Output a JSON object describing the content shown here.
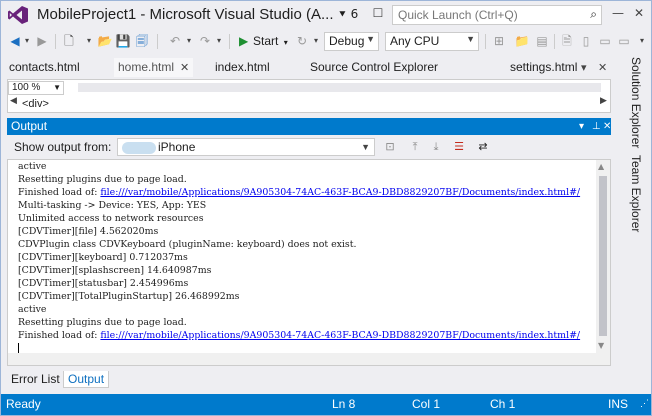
{
  "window": {
    "title": "MobileProject1 - Microsoft Visual Studio (A...",
    "notifications_count": "6",
    "quick_launch_placeholder": "Quick Launch (Ctrl+Q)"
  },
  "toolbar": {
    "start_label": "Start",
    "configuration": "Debug",
    "platform": "Any CPU"
  },
  "tabs": [
    {
      "label": "contacts.html"
    },
    {
      "label": "home.html"
    },
    {
      "label": "index.html"
    },
    {
      "label": "Source Control Explorer"
    },
    {
      "label": "settings.html"
    }
  ],
  "editor": {
    "zoom": "100 %",
    "breadcrumb": "<div>"
  },
  "output": {
    "title": "Output",
    "show_output_label": "Show output from:",
    "source_value": "iPhone",
    "lines": [
      {
        "text": "active"
      },
      {
        "text": "Resetting plugins due to page load."
      },
      {
        "text": "Finished load of: ",
        "link": "file:///var/mobile/Applications/9A905304-74AC-463F-BCA9-DBD8829207BF/Documents/index.html#/"
      },
      {
        "text": "Multi-tasking -> Device: YES, App: YES"
      },
      {
        "text": "Unlimited access to network resources"
      },
      {
        "text": "[CDVTimer][file] 4.562020ms"
      },
      {
        "text": "CDVPlugin class CDVKeyboard (pluginName: keyboard) does not exist."
      },
      {
        "text": "[CDVTimer][keyboard] 0.712037ms"
      },
      {
        "text": "[CDVTimer][splashscreen] 14.640987ms"
      },
      {
        "text": "[CDVTimer][statusbar] 2.454996ms"
      },
      {
        "text": "[CDVTimer][TotalPluginStartup] 26.468992ms"
      },
      {
        "text": "active"
      },
      {
        "text": "Resetting plugins due to page load."
      },
      {
        "text": "Finished load of: ",
        "link": "file:///var/mobile/Applications/9A905304-74AC-463F-BCA9-DBD8829207BF/Documents/index.html#/"
      }
    ]
  },
  "bottom_tabs": {
    "error_list": "Error List",
    "output": "Output"
  },
  "side_tabs": {
    "solution_explorer": "Solution Explorer",
    "team_explorer": "Team Explorer"
  },
  "statusbar": {
    "ready": "Ready",
    "line": "Ln 8",
    "col": "Col 1",
    "ch": "Ch 1",
    "mode": "INS"
  },
  "colors": {
    "accent": "#007acc",
    "vs_purple": "#68217a",
    "link": "#0000ee"
  }
}
